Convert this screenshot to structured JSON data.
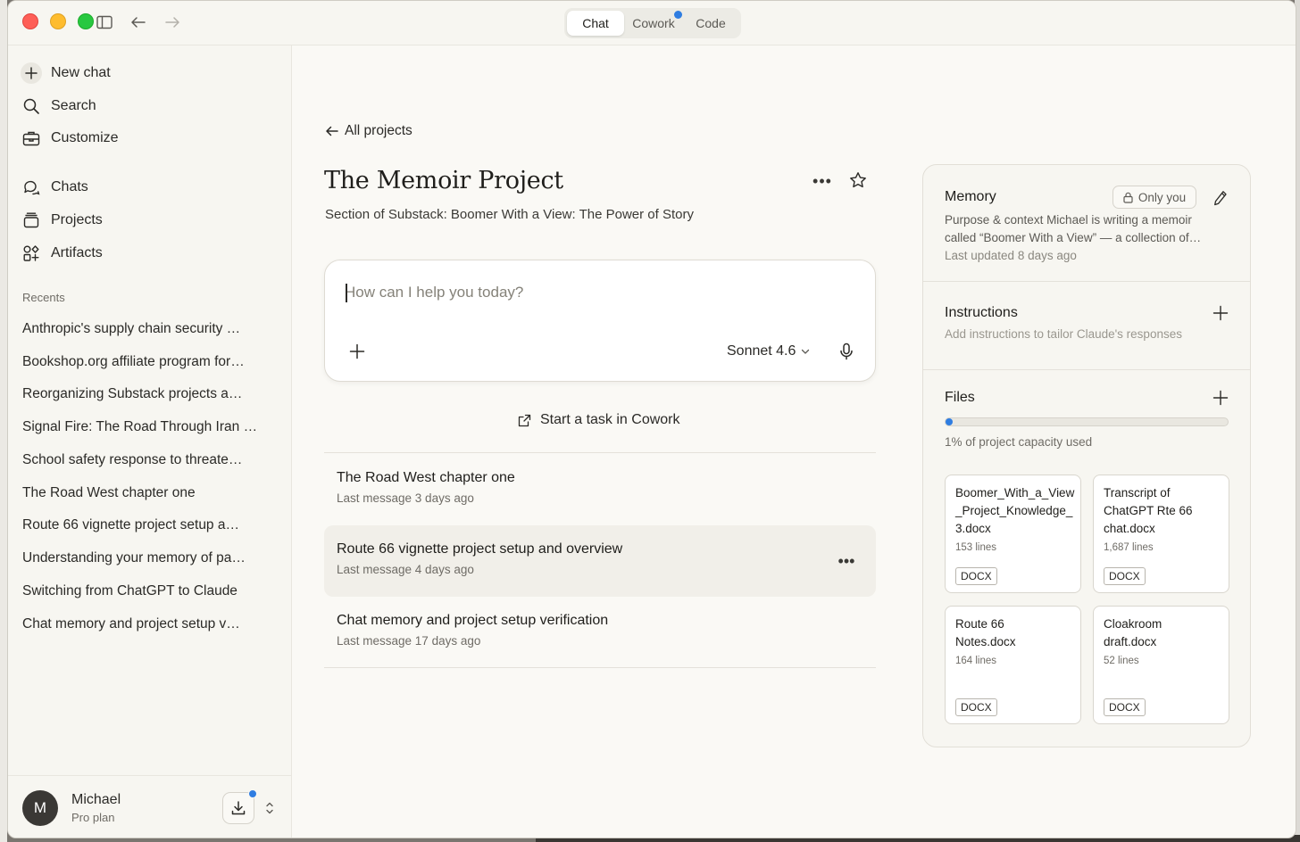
{
  "titlebar": {
    "modes": [
      {
        "label": "Chat",
        "active": true
      },
      {
        "label": "Cowork",
        "active": false,
        "notification": true
      },
      {
        "label": "Code",
        "active": false
      }
    ]
  },
  "sidebar": {
    "top_items": [
      {
        "label": "New chat",
        "icon": "plus-icon"
      },
      {
        "label": "Search",
        "icon": "search-icon"
      },
      {
        "label": "Customize",
        "icon": "briefcase-icon"
      }
    ],
    "nav_items": [
      {
        "label": "Chats",
        "icon": "chat-bubbles-icon"
      },
      {
        "label": "Projects",
        "icon": "folder-stack-icon"
      },
      {
        "label": "Artifacts",
        "icon": "shapes-icon"
      }
    ],
    "recents_label": "Recents",
    "recents": [
      "Anthropic's supply chain security …",
      "Bookshop.org affiliate program for…",
      "Reorganizing Substack projects a…",
      "Signal Fire: The Road Through Iran …",
      "School safety response to threate…",
      "The Road West chapter one",
      "Route 66 vignette project setup a…",
      "Understanding your memory of pa…",
      "Switching from ChatGPT to Claude",
      "Chat memory and project setup v…"
    ],
    "user": {
      "initial": "M",
      "name": "Michael",
      "plan": "Pro plan"
    }
  },
  "main": {
    "back_label": "All projects",
    "project_title": "The Memoir Project",
    "project_description": "Section of Substack: Boomer With a View: The Power of Story",
    "composer": {
      "placeholder": "How can I help you today?",
      "model": "Sonnet 4.6"
    },
    "cowork_label": "Start a task in Cowork",
    "conversations": [
      {
        "title": "The Road West chapter one",
        "meta": "Last message 3 days ago"
      },
      {
        "title": "Route 66 vignette project setup and overview",
        "meta": "Last message 4 days ago"
      },
      {
        "title": "Chat memory and project setup verification",
        "meta": "Last message 17 days ago"
      }
    ]
  },
  "panel": {
    "memory": {
      "title": "Memory",
      "visibility": "Only you",
      "text_line1": "Purpose & context Michael is writing a memoir",
      "text_line2": "called “Boomer With a View” — a collection of…",
      "updated": "Last updated 8 days ago"
    },
    "instructions": {
      "title": "Instructions",
      "placeholder": "Add instructions to tailor Claude's responses"
    },
    "files": {
      "title": "Files",
      "capacity_fraction": 0.01,
      "capacity_label": "1% of project capacity used",
      "items": [
        {
          "name": "Boomer_With_a_View_Project_Knowledge_3.docx",
          "lines": "153 lines",
          "type": "DOCX"
        },
        {
          "name": "Transcript of ChatGPT Rte 66 chat.docx",
          "lines": "1,687 lines",
          "type": "DOCX"
        },
        {
          "name": "Route 66 Notes.docx",
          "lines": "164 lines",
          "type": "DOCX"
        },
        {
          "name": "Cloakroom draft.docx",
          "lines": "52 lines",
          "type": "DOCX"
        }
      ]
    }
  },
  "colors": {
    "accent_blue": "#2f7de1",
    "window_bg": "#faf9f5",
    "sidebar_bg": "#f7f6f1"
  }
}
